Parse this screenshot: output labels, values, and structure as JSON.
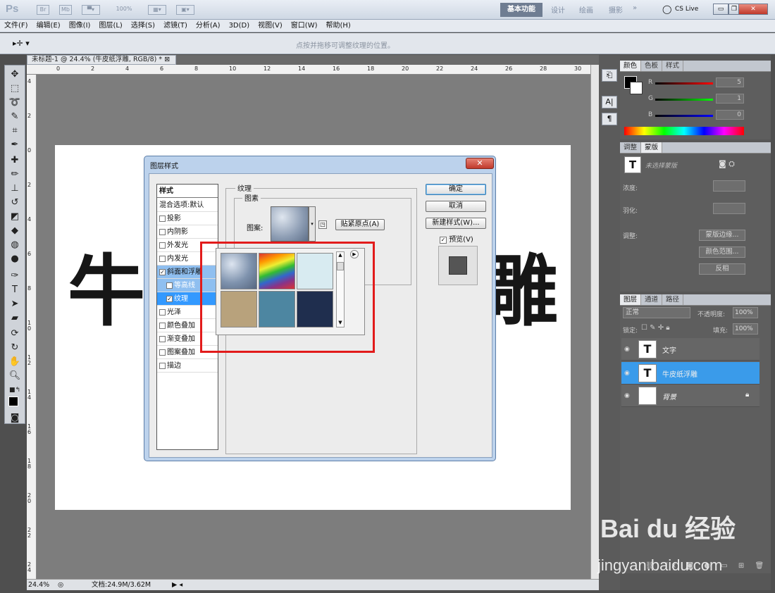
{
  "app": {
    "logo": "Ps",
    "top_chips": [
      "Br",
      "Mb",
      "100%"
    ],
    "workspaces": [
      "基本功能",
      "设计",
      "绘画",
      "摄影",
      "»"
    ],
    "cslive": "CS Live",
    "menus": [
      "文件(F)",
      "编辑(E)",
      "图像(I)",
      "图层(L)",
      "选择(S)",
      "滤镜(T)",
      "分析(A)",
      "3D(D)",
      "视图(V)",
      "窗口(W)",
      "帮助(H)"
    ],
    "option_hint": "点按并拖移可调整纹理的位置。"
  },
  "document": {
    "tab_title": "未标题-1 @ 24.4% (牛皮纸浮雕, RGB/8) *",
    "ruler_h_ticks": [
      "0",
      "2",
      "4",
      "6",
      "8",
      "10",
      "12",
      "14",
      "16",
      "18",
      "20",
      "22",
      "24",
      "26",
      "28",
      "30"
    ],
    "ruler_v_ticks": [
      "4",
      "2",
      "0",
      "2",
      "4",
      "6",
      "8",
      "1\n0",
      "1\n2",
      "1\n4",
      "1\n6",
      "1\n8",
      "2\n0",
      "2\n2",
      "2\n4"
    ],
    "canvas_chars": [
      "牛",
      "雕"
    ],
    "zoom": "24.4%",
    "doc_info": "文档:24.9M/3.62M"
  },
  "dialog": {
    "title": "图层样式",
    "style_header": "样式",
    "blend_item": "混合选项:默认",
    "styles": [
      {
        "label": "投影",
        "checked": false
      },
      {
        "label": "内阴影",
        "checked": false
      },
      {
        "label": "外发光",
        "checked": false
      },
      {
        "label": "内发光",
        "checked": false
      },
      {
        "label": "斜面和浮雕",
        "checked": true
      },
      {
        "label": "等高线",
        "checked": false
      },
      {
        "label": "纹理",
        "checked": true
      },
      {
        "label": "光泽",
        "checked": false
      },
      {
        "label": "颜色叠加",
        "checked": false
      },
      {
        "label": "渐变叠加",
        "checked": false
      },
      {
        "label": "图案叠加",
        "checked": false
      },
      {
        "label": "描边",
        "checked": false
      }
    ],
    "group_texture": "纹理",
    "group_pattern": "图素",
    "pattern_label": "图案:",
    "snap_button": "贴紧原点(A)",
    "ok_button": "确定",
    "cancel_button": "取消",
    "new_style_button": "新建样式(W)...",
    "preview_label": "预览(V)",
    "preview_checked": true
  },
  "panels": {
    "color_tabs": [
      "颜色",
      "色板",
      "样式"
    ],
    "rgb": [
      {
        "ch": "R",
        "val": "5"
      },
      {
        "ch": "G",
        "val": "1"
      },
      {
        "ch": "B",
        "val": "0"
      }
    ],
    "adjust_tabs": [
      "调整",
      "蒙版"
    ],
    "mask_title": "未选择蒙版",
    "mask_density": "浓度:",
    "mask_feather": "羽化:",
    "mask_adjust": "调整:",
    "mask_buttons": [
      "蒙版边缘...",
      "颜色范围...",
      "反相"
    ],
    "layer_tabs": [
      "图层",
      "通道",
      "路径"
    ],
    "blend_mode": "正常",
    "opacity_label": "不透明度:",
    "opacity": "100%",
    "lock_label": "锁定:",
    "fill_label": "填充:",
    "fill": "100%",
    "layers": [
      {
        "name": "文字",
        "selected": false
      },
      {
        "name": "牛皮纸浮雕",
        "selected": true
      },
      {
        "name": "背景",
        "selected": false
      }
    ]
  },
  "watermark": {
    "brand": "Bai du 经验",
    "url": "jingyan.baidu.com"
  }
}
